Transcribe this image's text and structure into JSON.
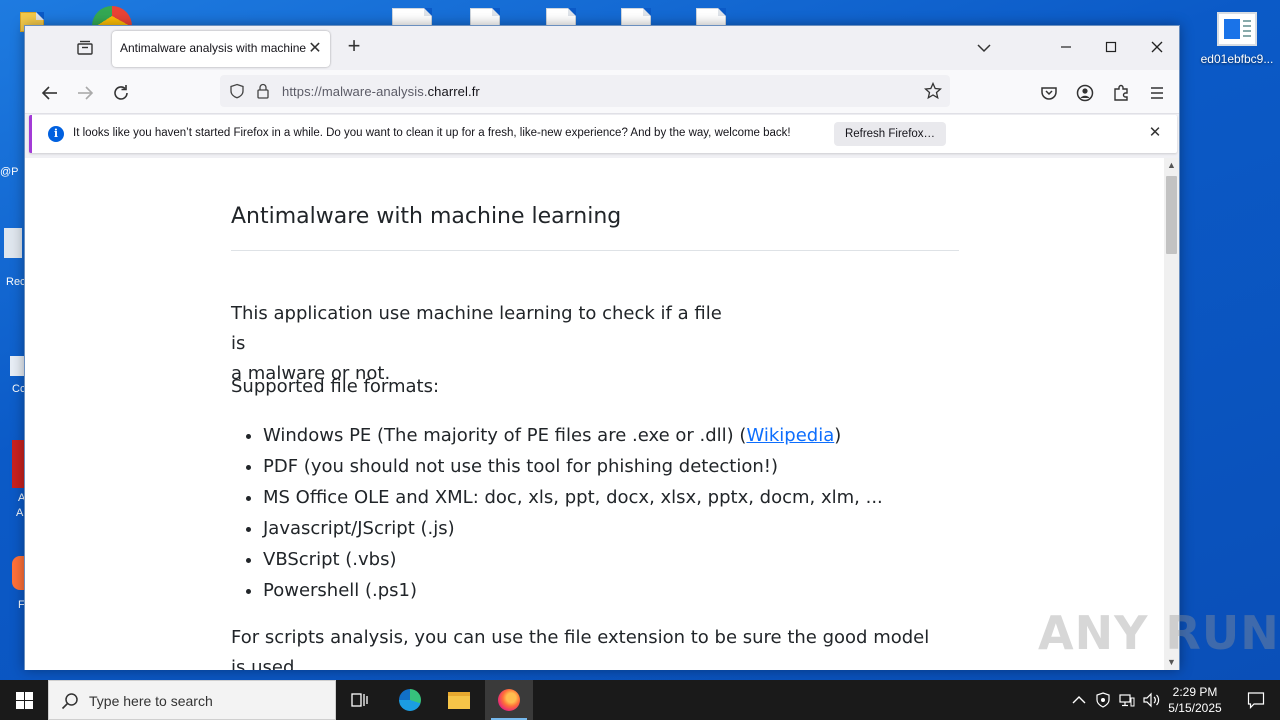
{
  "browser": {
    "tab_title": "Antimalware analysis with machine learning",
    "url_prefix": "https://malware-analysis.",
    "url_domain": "charrel.fr",
    "notification": {
      "text": "It looks like you haven’t started Firefox in a while. Do you want to clean it up for a fresh, like-new experience? And by the way, welcome back!",
      "button": "Refresh Firefox…"
    }
  },
  "page": {
    "title": "Antimalware with machine learning",
    "intro_line1": "This application use machine learning to check if a file is",
    "intro_line2": "a malware or not.",
    "formats_heading": "Supported file formats:",
    "formats": [
      "Windows PE (The majority of PE files are .exe or .dll) (",
      "PDF (you should not use this tool for phishing detection!)",
      "MS Office OLE and XML: doc, xls, ppt, docx, xlsx, pptx, docm, xlm, ...",
      "Javascript/JScript (.js)",
      "VBScript (.vbs)",
      "Powershell (.ps1)"
    ],
    "wikipedia_link": "Wikipedia",
    "link_close": ")",
    "scripts_text": "For scripts analysis, you can use the file extension to be sure the good model is used."
  },
  "desktop": {
    "right_icon_label": "ed01ebfbc9...",
    "left_labels": [
      "@P",
      "Rec",
      "Cc",
      "A",
      "A",
      "F"
    ],
    "watermark": "ANY RUN"
  },
  "taskbar": {
    "search_placeholder": "Type here to search",
    "time": "2:29 PM",
    "date": "5/15/2025"
  },
  "colors": {
    "link": "#0d6efd",
    "notification_accent": "#a33bd6",
    "info_icon": "#0060df",
    "taskbar": "#1a1a1a"
  }
}
